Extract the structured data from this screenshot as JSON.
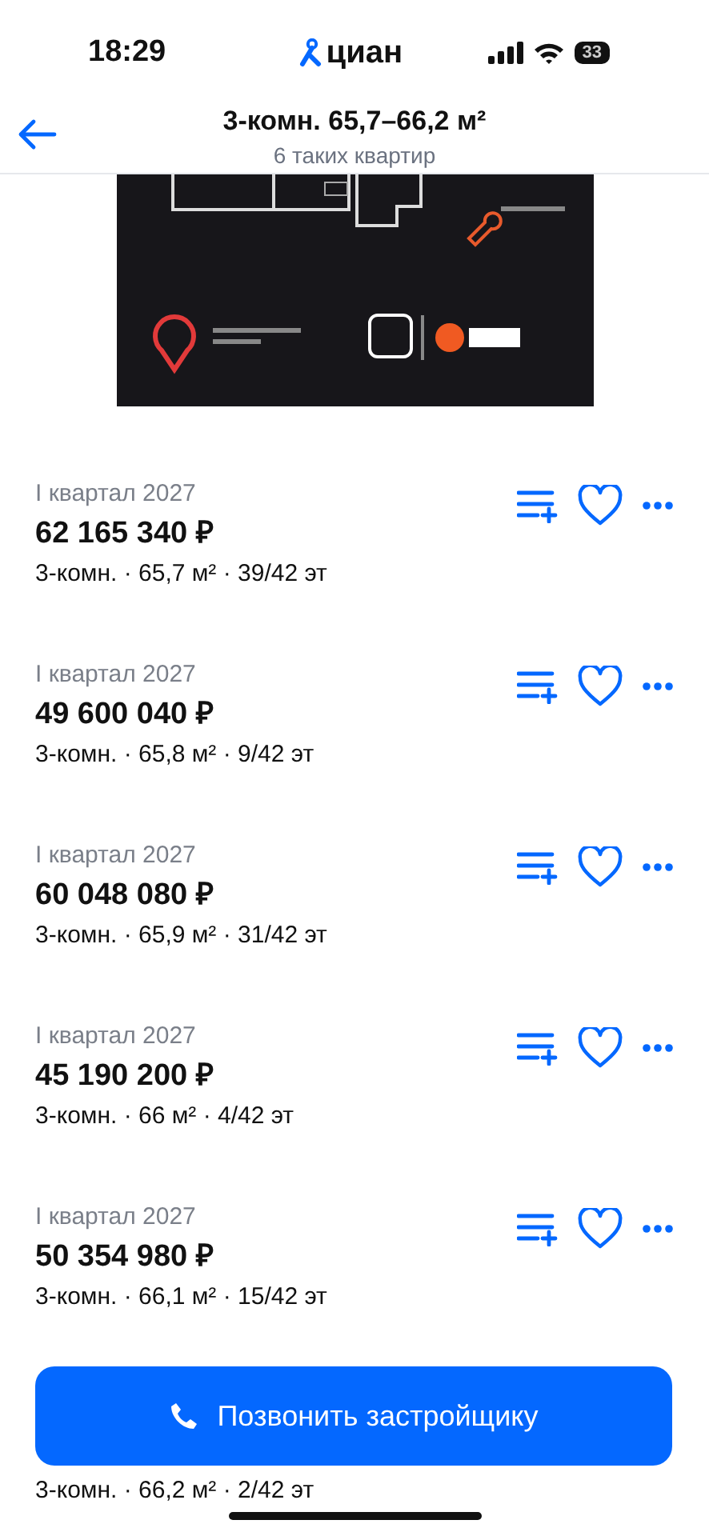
{
  "status_bar": {
    "time": "18:29",
    "app_logo": "циан",
    "battery": "33"
  },
  "header": {
    "title": "3-комн. 65,7–66,2 м²",
    "subtitle": "6 таких квартир"
  },
  "listings": [
    {
      "date": "I квартал 2027",
      "price": "62 165 340 ₽",
      "spec": "3-комн. · 65,7 м² · 39/42 эт",
      "favorite": false
    },
    {
      "date": "I квартал 2027",
      "price": "49 600 040 ₽",
      "spec": "3-комн. · 65,8 м² · 9/42 эт",
      "favorite": false
    },
    {
      "date": "I квартал 2027",
      "price": "60 048 080 ₽",
      "spec": "3-комн. · 65,9 м² · 31/42 эт",
      "favorite": false
    },
    {
      "date": "I квартал 2027",
      "price": "45 190 200 ₽",
      "spec": "3-комн. · 66 м² · 4/42 эт",
      "favorite": false
    },
    {
      "date": "I квартал 2027",
      "price": "50 354 980 ₽",
      "spec": "3-комн. · 66,1 м² · 15/42 эт",
      "favorite": false
    },
    {
      "spec": "3-комн. · 66,2 м² · 2/42 эт"
    }
  ],
  "call_button": {
    "label": "Позвонить застройщику"
  }
}
